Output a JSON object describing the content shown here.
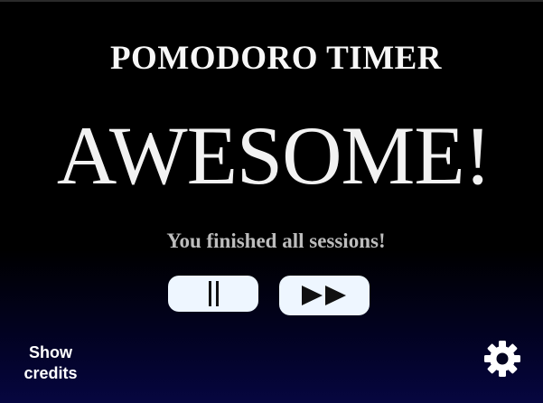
{
  "app": {
    "title": "POMODORO TIMER",
    "headline": "AWESOME!",
    "message": "You finished all sessions!"
  },
  "controls": {
    "pause_icon": "pause-icon",
    "next_icon": "fast-forward-icon"
  },
  "footer": {
    "credits_label": "Show credits",
    "settings_icon": "gear-icon"
  },
  "colors": {
    "background_top": "#000000",
    "background_bottom": "#060640",
    "button_fill": "#eef6ff",
    "message_text": "#bdbdbd"
  }
}
